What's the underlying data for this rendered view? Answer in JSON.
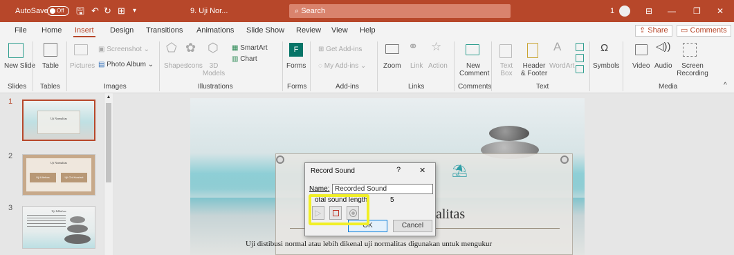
{
  "titlebar": {
    "autosave_label": "AutoSave",
    "autosave_state": "Off",
    "filename": "9. Uji Nor...",
    "search_placeholder": "Search",
    "user_initial": "1",
    "colors": {
      "accent": "#b7472a"
    }
  },
  "menu": {
    "tabs": [
      "File",
      "Home",
      "Insert",
      "Design",
      "Transitions",
      "Animations",
      "Slide Show",
      "Review",
      "View",
      "Help"
    ],
    "active_tab": "Insert",
    "share_label": "Share",
    "comments_label": "Comments"
  },
  "ribbon": {
    "new_slide": "New Slide",
    "table": "Table",
    "pictures": "Pictures",
    "screenshot": "Screenshot",
    "photo_album": "Photo Album",
    "shapes": "Shapes",
    "icons": "Icons",
    "models": "3D Models",
    "smartart": "SmartArt",
    "chart": "Chart",
    "forms": "Forms",
    "get_addins": "Get Add-ins",
    "my_addins": "My Add-ins",
    "zoom": "Zoom",
    "link": "Link",
    "action": "Action",
    "new_comment": "New Comment",
    "text_box": "Text Box",
    "header_footer": "Header & Footer",
    "wordart": "WordArt",
    "symbols": "Symbols",
    "video": "Video",
    "audio": "Audio",
    "screen_recording": "Screen Recording",
    "groups": {
      "slides": "Slides",
      "tables": "Tables",
      "images": "Images",
      "illustrations": "Illustrations",
      "forms": "Forms",
      "addins": "Add-ins",
      "links": "Links",
      "comments": "Comments",
      "text": "Text",
      "media": "Media"
    }
  },
  "thumbnails": {
    "numbers": [
      "1",
      "2",
      "3"
    ],
    "slide1_title": "Uji Normalitas",
    "slide2_title": "Uji Normalitas",
    "slide2_btn1": "Uji Liliefors",
    "slide2_btn2": "Uji Chi Kuadrat",
    "slide3_title": "Uji Lilliefors"
  },
  "slide": {
    "title_partial": "alitas",
    "body_text": "Uji distibusi normal atau lebih dikenal uji normalitas digunakan untuk mengukur"
  },
  "dialog": {
    "title": "Record Sound",
    "help": "?",
    "close": "✕",
    "name_label": "Name:",
    "name_value": "Recorded Sound",
    "length_label": "otal sound length:",
    "length_value": "5",
    "ok": "OK",
    "cancel": "Cancel",
    "highlight_color": "#f1ef26"
  }
}
